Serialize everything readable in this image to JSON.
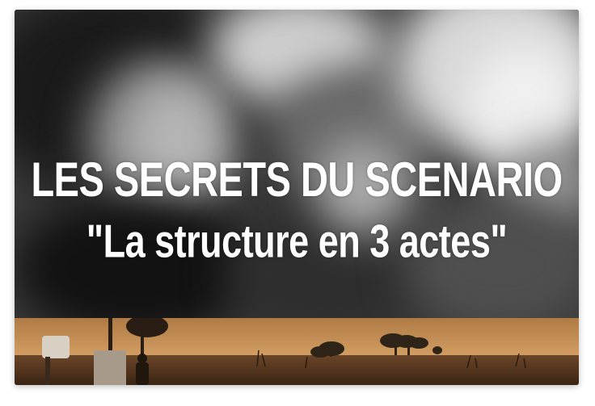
{
  "video": {
    "title_line_1": "LES SECRETS DU SCENARIO",
    "title_line_2": "\"La structure en 3 actes\"",
    "colors": {
      "title_text": "#ffffff",
      "sky": "#c8955a",
      "field": "#5a3a22"
    }
  }
}
